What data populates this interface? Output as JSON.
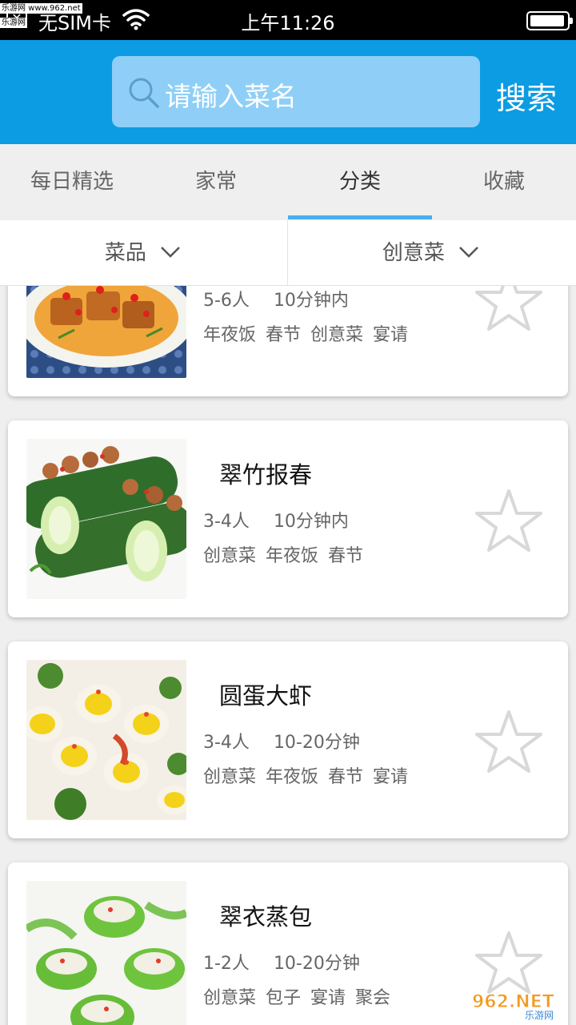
{
  "status_bar": {
    "carrier": "无SIM卡",
    "time": "上午11:26",
    "close_glyph": "✕",
    "source_label": "乐游网 www.962.net",
    "source_label2": "乐游网"
  },
  "header": {
    "search_placeholder": "请输入菜名",
    "search_button": "搜索"
  },
  "tabs": [
    {
      "label": "每日精选",
      "active": false
    },
    {
      "label": "家常",
      "active": false
    },
    {
      "label": "分类",
      "active": true
    },
    {
      "label": "收藏",
      "active": false
    }
  ],
  "filters": {
    "left": "菜品",
    "right": "创意菜"
  },
  "dishes": [
    {
      "title": "",
      "people": "5-6人",
      "time": "10分钟内",
      "tags": [
        "年夜饭",
        "春节",
        "创意菜",
        "宴请"
      ]
    },
    {
      "title": "翠竹报春",
      "people": "3-4人",
      "time": "10分钟内",
      "tags": [
        "创意菜",
        "年夜饭",
        "春节"
      ]
    },
    {
      "title": "圆蛋大虾",
      "people": "3-4人",
      "time": "10-20分钟",
      "tags": [
        "创意菜",
        "年夜饭",
        "春节",
        "宴请"
      ]
    },
    {
      "title": "翠衣蒸包",
      "people": "1-2人",
      "time": "10-20分钟",
      "tags": [
        "创意菜",
        "包子",
        "宴请",
        "聚会"
      ]
    }
  ],
  "watermark": {
    "text": "962.NET",
    "sub": "乐游网"
  },
  "colors": {
    "header_blue": "#0b9ce3",
    "search_bg": "#8fcff7",
    "tab_indicator": "#47aef0"
  }
}
